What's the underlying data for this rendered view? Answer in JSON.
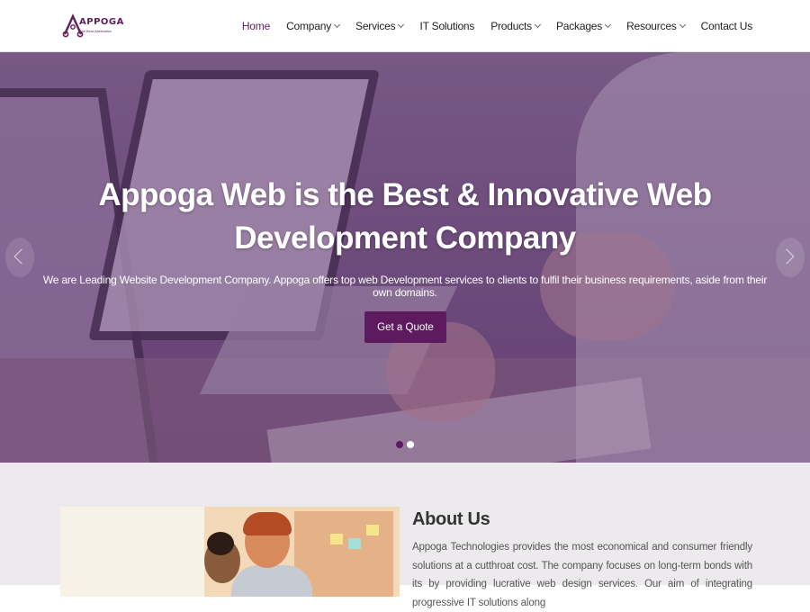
{
  "header": {
    "logo": {
      "name": "APPOGA",
      "tagline": "The Best Alternative"
    },
    "nav": [
      {
        "label": "Home",
        "active": true,
        "has_dropdown": false
      },
      {
        "label": "Company",
        "active": false,
        "has_dropdown": true
      },
      {
        "label": "Services",
        "active": false,
        "has_dropdown": true
      },
      {
        "label": "IT Solutions",
        "active": false,
        "has_dropdown": false
      },
      {
        "label": "Products",
        "active": false,
        "has_dropdown": true
      },
      {
        "label": "Packages",
        "active": false,
        "has_dropdown": true
      },
      {
        "label": "Resources",
        "active": false,
        "has_dropdown": true
      },
      {
        "label": "Contact Us",
        "active": false,
        "has_dropdown": false
      }
    ]
  },
  "hero": {
    "title": "Appoga Web is the Best & Innovative Web Development Company",
    "subtitle": "We are Leading Website Development Company. Appoga offers top web Development services to clients to fulfil their business requirements, aside from their own domains.",
    "cta_label": "Get a Quote",
    "slides_count": 2,
    "active_slide": 1
  },
  "about": {
    "title": "About Us",
    "text": "Appoga Technologies provides the most economical and consumer friendly solutions at a cutthroat cost. The company focuses on long-term bonds with its by providing lucrative web design services. Our aim of integrating progressive IT solutions along"
  },
  "colors": {
    "brand": "#5e1a5e",
    "hero_overlay": "#6b4a79",
    "about_bg": "#eceaec"
  }
}
